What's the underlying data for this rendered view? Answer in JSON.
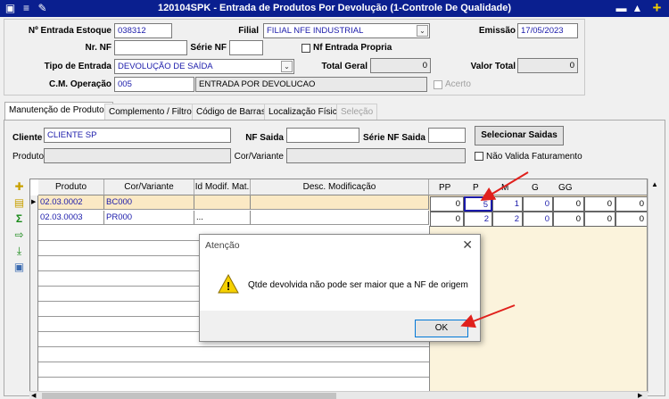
{
  "window": {
    "title": "120104SPK - Entrada de Produtos Por Devolução (1-Controle De Qualidade)"
  },
  "header": {
    "nr_entrada_label": "Nº Entrada Estoque",
    "nr_entrada_value": "038312",
    "filial_label": "Filial",
    "filial_value": "FILIAL NFE INDUSTRIAL",
    "emissao_label": "Emissão",
    "emissao_value": "17/05/2023",
    "nr_nf_label": "Nr. NF",
    "nr_nf_value": "",
    "serie_nf_label": "Série NF",
    "serie_nf_value": "",
    "nf_entrada_propria_label": "Nf Entrada Propria",
    "tipo_entrada_label": "Tipo de Entrada",
    "tipo_entrada_value": "DEVOLUÇÃO DE SAÍDA",
    "total_geral_label": "Total Geral",
    "total_geral_value": "0",
    "valor_total_label": "Valor Total",
    "valor_total_value": "0",
    "cm_operacao_label": "C.M. Operação",
    "cm_operacao_code": "005",
    "cm_operacao_desc": "ENTRADA POR DEVOLUCAO",
    "acerto_label": "Acerto"
  },
  "tabs": [
    {
      "label": "Manutenção de Produtos"
    },
    {
      "label": "Complemento / Filtros"
    },
    {
      "label": "Código de Barras"
    },
    {
      "label": "Localização Física"
    },
    {
      "label": "Seleção"
    }
  ],
  "tab_content": {
    "cliente_label": "Cliente",
    "cliente_value": "CLIENTE SP",
    "nf_saida_label": "NF Saida",
    "nf_saida_value": "",
    "serie_nf_saida_label": "Série NF Saida",
    "serie_nf_saida_value": "",
    "selecionar_saidas_label": "Selecionar Saidas",
    "produto_label": "Produto",
    "cor_variante_label": "Cor/Variante",
    "nao_valida_faturamento_label": "Não Valida Faturamento"
  },
  "grid": {
    "columns": [
      "Produto",
      "Cor/Variante",
      "Id Modif. Mat.",
      "Desc. Modificação"
    ],
    "size_columns": [
      "PP",
      "P",
      "M",
      "G",
      "GG"
    ],
    "rows": [
      {
        "produto": "02.03.0002",
        "cor": "BC000",
        "id_modif": "",
        "desc": "",
        "sizes": [
          "0",
          "5",
          "1",
          "0",
          "0",
          "0",
          "0"
        ]
      },
      {
        "produto": "02.03.0003",
        "cor": "PR000",
        "id_modif": "...",
        "desc": "",
        "sizes": [
          "0",
          "2",
          "2",
          "0",
          "0",
          "0",
          "0"
        ]
      }
    ]
  },
  "dialog": {
    "title": "Atenção",
    "message": "Qtde devolvida não pode ser maior que a NF de origem",
    "ok_label": "OK"
  },
  "colors": {
    "titlebar": "#0a1f8f",
    "highlight_row": "#fbe9c4",
    "arrow": "#e0201c",
    "data_text": "#1a1aaa"
  }
}
